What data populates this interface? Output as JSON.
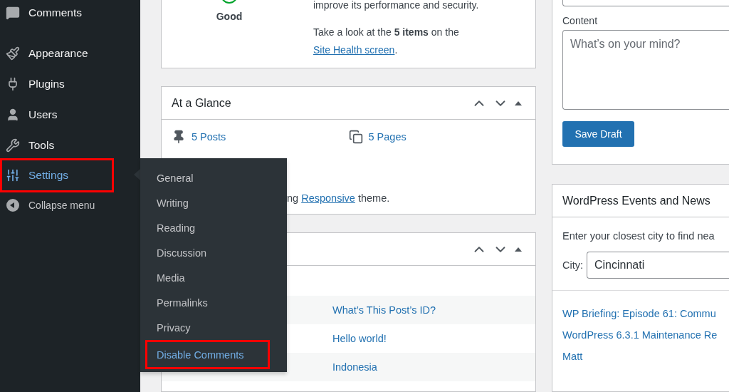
{
  "sidebar": {
    "items": [
      {
        "label": "Comments",
        "kind": "comments",
        "selected": false,
        "highlighted": false
      },
      {
        "label": "Appearance",
        "kind": "appearance",
        "selected": false,
        "highlighted": false
      },
      {
        "label": "Plugins",
        "kind": "plugins",
        "selected": false,
        "highlighted": false
      },
      {
        "label": "Users",
        "kind": "users",
        "selected": false,
        "highlighted": false
      },
      {
        "label": "Tools",
        "kind": "tools",
        "selected": false,
        "highlighted": false
      },
      {
        "label": "Settings",
        "kind": "settings",
        "selected": true,
        "highlighted": true
      }
    ],
    "collapse": "Collapse menu"
  },
  "flyout": {
    "items": [
      {
        "label": "General",
        "selected": false,
        "highlighted": false
      },
      {
        "label": "Writing",
        "selected": false,
        "highlighted": false
      },
      {
        "label": "Reading",
        "selected": false,
        "highlighted": false
      },
      {
        "label": "Discussion",
        "selected": false,
        "highlighted": false
      },
      {
        "label": "Media",
        "selected": false,
        "highlighted": false
      },
      {
        "label": "Permalinks",
        "selected": false,
        "highlighted": false
      },
      {
        "label": "Privacy",
        "selected": false,
        "highlighted": false
      },
      {
        "label": "Disable Comments",
        "selected": true,
        "highlighted": true
      }
    ]
  },
  "site_health": {
    "status": "Good",
    "text": "improve its performance and security.",
    "details": "Take a look at the **5 items** on the",
    "link": "Site Health screen",
    "after": "."
  },
  "at_a_glance": {
    "title": "At a Glance",
    "items": [
      {
        "kind": "posts",
        "label": "5 Posts"
      },
      {
        "kind": "pages",
        "label": "5 Pages"
      }
    ],
    "theme_before": "ng",
    "theme_link": "Responsive",
    "theme_after": " theme."
  },
  "activity": {
    "rows": [
      {
        "link": "What’s This Post’s ID?"
      },
      {
        "link": "Hello world!"
      },
      {
        "link": "Indonesia"
      }
    ]
  },
  "quick_draft": {
    "content_label": "Content",
    "placeholder": "What’s on your mind?",
    "button": "Save Draft"
  },
  "events": {
    "title": "WordPress Events and News",
    "intro": "Enter your closest city to find nea",
    "city_label": "City:",
    "city_value": "Cincinnati",
    "links": [
      "WP Briefing: Episode 61: Commu",
      "WordPress 6.3.1 Maintenance Re",
      "Matt"
    ]
  }
}
